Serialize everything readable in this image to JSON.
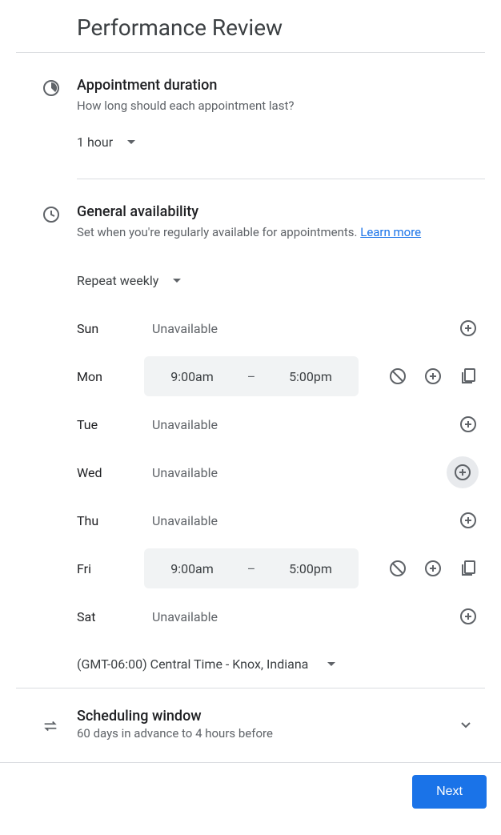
{
  "title": "Performance Review",
  "duration": {
    "heading": "Appointment duration",
    "subtitle": "How long should each appointment last?",
    "value": "1 hour"
  },
  "availability": {
    "heading": "General availability",
    "subtitle_prefix": "Set when you're regularly available for appointments. ",
    "learn_more": "Learn more",
    "repeat_label": "Repeat weekly",
    "days": {
      "sun": {
        "label": "Sun",
        "status": "Unavailable"
      },
      "mon": {
        "label": "Mon",
        "start": "9:00am",
        "end": "5:00pm"
      },
      "tue": {
        "label": "Tue",
        "status": "Unavailable"
      },
      "wed": {
        "label": "Wed",
        "status": "Unavailable"
      },
      "thu": {
        "label": "Thu",
        "status": "Unavailable"
      },
      "fri": {
        "label": "Fri",
        "start": "9:00am",
        "end": "5:00pm"
      },
      "sat": {
        "label": "Sat",
        "status": "Unavailable"
      },
      "dash": "–"
    },
    "timezone": "(GMT-06:00) Central Time - Knox, Indiana"
  },
  "scheduling": {
    "heading": "Scheduling window",
    "subtitle": "60 days in advance to 4 hours before"
  },
  "footer": {
    "next": "Next"
  }
}
